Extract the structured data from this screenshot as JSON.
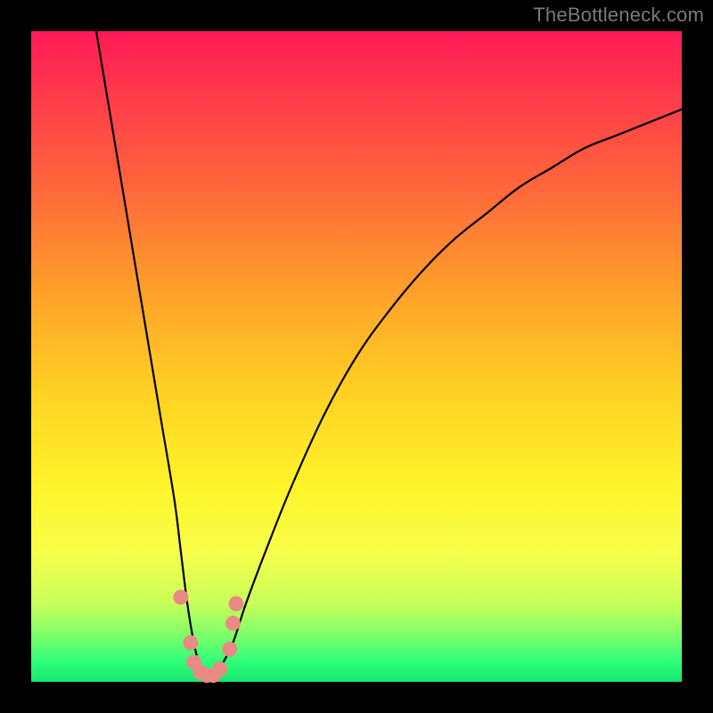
{
  "watermark": "TheBottleneck.com",
  "chart_data": {
    "type": "line",
    "title": "",
    "xlabel": "",
    "ylabel": "",
    "xlim": [
      0,
      100
    ],
    "ylim": [
      0,
      100
    ],
    "grid": false,
    "legend": false,
    "series": [
      {
        "name": "bottleneck-curve",
        "color": "#000000",
        "x": [
          10,
          12,
          14,
          16,
          18,
          20,
          22,
          23,
          24,
          25,
          26,
          27,
          28,
          29,
          31,
          33,
          36,
          40,
          45,
          50,
          55,
          60,
          65,
          70,
          75,
          80,
          85,
          90,
          95,
          100
        ],
        "y": [
          100,
          88,
          76,
          64,
          52,
          40,
          28,
          20,
          12,
          6,
          2,
          0,
          0,
          2,
          6,
          12,
          20,
          30,
          41,
          50,
          57,
          63,
          68,
          72,
          76,
          79,
          82,
          84,
          86,
          88
        ]
      }
    ],
    "markers": [
      {
        "name": "marker",
        "x": 23.0,
        "y": 13.0,
        "color": "#e98b84"
      },
      {
        "name": "marker",
        "x": 24.5,
        "y": 6.0,
        "color": "#e98b84"
      },
      {
        "name": "marker",
        "x": 25.0,
        "y": 3.0,
        "color": "#e98b84"
      },
      {
        "name": "marker",
        "x": 26.0,
        "y": 1.5,
        "color": "#e98b84"
      },
      {
        "name": "marker",
        "x": 27.0,
        "y": 1.0,
        "color": "#e98b84"
      },
      {
        "name": "marker",
        "x": 28.0,
        "y": 1.0,
        "color": "#e98b84"
      },
      {
        "name": "marker",
        "x": 29.0,
        "y": 2.0,
        "color": "#e98b84"
      },
      {
        "name": "marker",
        "x": 30.5,
        "y": 5.0,
        "color": "#e98b84"
      },
      {
        "name": "marker",
        "x": 31.0,
        "y": 9.0,
        "color": "#e98b84"
      },
      {
        "name": "marker",
        "x": 31.5,
        "y": 12.0,
        "color": "#e98b84"
      }
    ]
  }
}
